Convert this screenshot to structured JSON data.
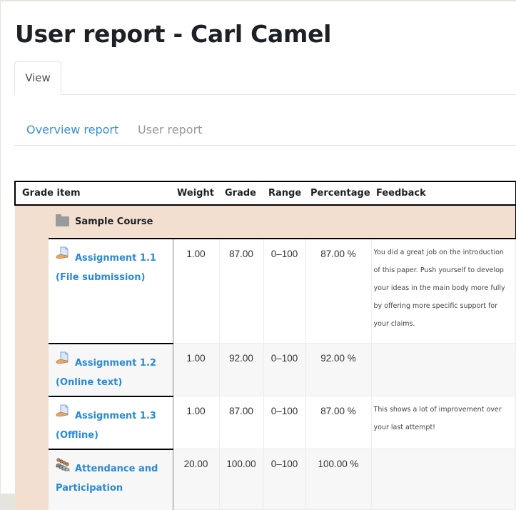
{
  "page": {
    "title": "User report - Carl Camel"
  },
  "tabs": [
    {
      "label": "View",
      "active": true
    }
  ],
  "subnav": {
    "overview_label": "Overview report",
    "user_label": "User report"
  },
  "table": {
    "headers": [
      "Grade item",
      "Weight",
      "Grade",
      "Range",
      "Percentage",
      "Feedback"
    ],
    "course": {
      "name": "Sample Course",
      "icon": "folder-icon"
    },
    "rows": [
      {
        "icon": "assignment-icon",
        "name_line1": "Assignment 1.1",
        "name_line2": "(File submission)",
        "weight": "1.00",
        "grade": "87.00",
        "range": "0–100",
        "percentage": "87.00 %",
        "feedback": "You did a great job on the introduction of this paper. Push yourself to develop your ideas in the main body more fully by offering more specific support for your claims."
      },
      {
        "icon": "assignment-icon",
        "name_line1": "Assignment 1.2",
        "name_line2": "(Online text)",
        "weight": "1.00",
        "grade": "92.00",
        "range": "0–100",
        "percentage": "92.00 %",
        "feedback": ""
      },
      {
        "icon": "assignment-icon",
        "name_line1": "Assignment 1.3",
        "name_line2": "(Offline)",
        "weight": "1.00",
        "grade": "87.00",
        "range": "0–100",
        "percentage": "87.00 %",
        "feedback": "This shows a lot of improvement over your last attempt!"
      },
      {
        "icon": "attendance-icon",
        "name_line1": "Attendance and",
        "name_line2": "Participation",
        "weight": "20.00",
        "grade": "100.00",
        "range": "0–100",
        "percentage": "100.00 %",
        "feedback": ""
      }
    ]
  },
  "colors": {
    "link": "#2a8ad6",
    "category_bg": "#f2dfd0",
    "muted_link": "#999999"
  }
}
